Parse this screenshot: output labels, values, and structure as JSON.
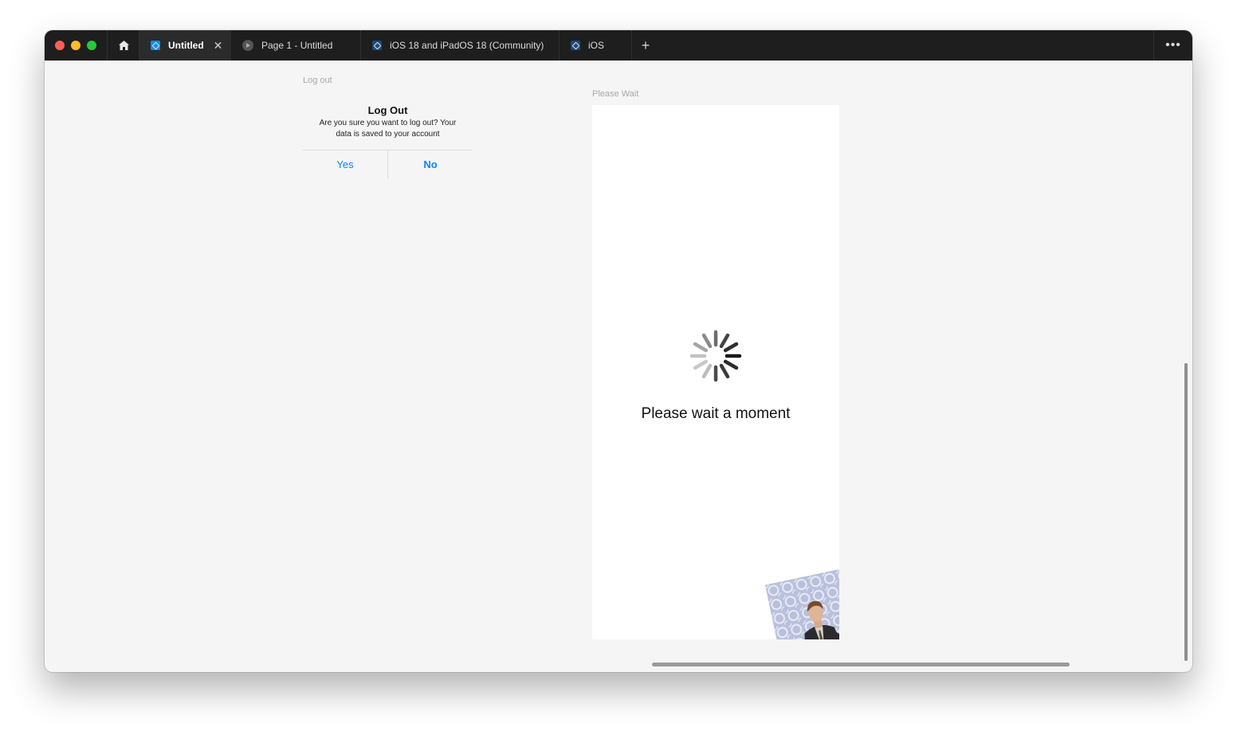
{
  "tabbar": {
    "tabs": [
      {
        "label": "Untitled",
        "icon": "figma-file-icon",
        "active": true,
        "close": "✕"
      },
      {
        "label": "Page 1 - Untitled",
        "icon": "play-icon"
      },
      {
        "label": "iOS 18 and iPadOS 18 (Community)",
        "icon": "figma-file-icon"
      },
      {
        "label": "iOS",
        "icon": "figma-file-icon"
      }
    ],
    "new_tab": "+",
    "more": "•••"
  },
  "canvas": {
    "logout_frame_label": "Log out",
    "alert": {
      "title": "Log Out",
      "message": "Are you sure you want to log out? Your data is saved to your account",
      "yes": "Yes",
      "no": "No"
    },
    "wait_frame_label": "Please Wait",
    "wait_text": "Please wait a moment"
  },
  "colors": {
    "accent": "#0a84ff",
    "tabbar_bg": "#1e1e1e",
    "canvas_bg": "#f5f5f5"
  }
}
